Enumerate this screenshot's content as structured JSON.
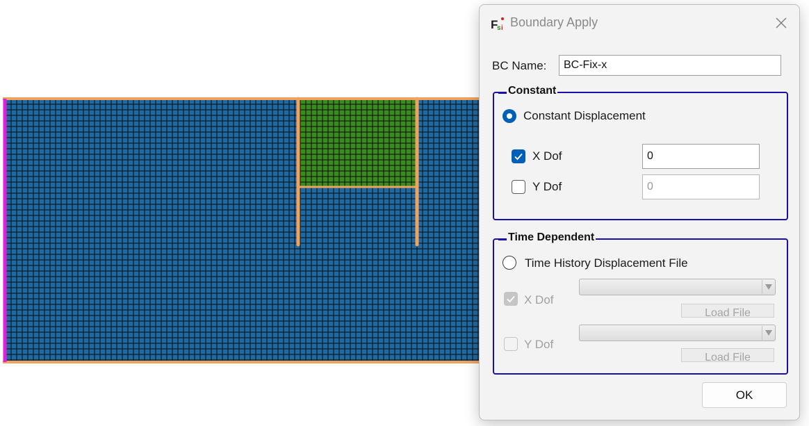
{
  "dialog": {
    "title": "Boundary Apply",
    "bc_name_label": "BC Name:",
    "bc_name_value": "BC-Fix-x",
    "constant": {
      "legend": "Constant",
      "mode_label": "Constant Displacement",
      "mode_selected": true,
      "x_dof": {
        "label": "X Dof",
        "checked": true,
        "value": "0"
      },
      "y_dof": {
        "label": "Y Dof",
        "checked": false,
        "value": "0"
      }
    },
    "time_dependent": {
      "legend": "Time Dependent",
      "mode_label": "Time History Displacement File",
      "mode_selected": false,
      "x_dof": {
        "label": "X Dof",
        "checked": true,
        "enabled": false,
        "load_label": "Load File"
      },
      "y_dof": {
        "label": "Y Dof",
        "checked": false,
        "enabled": false,
        "load_label": "Load File"
      }
    },
    "ok_label": "OK"
  },
  "mesh": {
    "colors": {
      "soil_fill": "#1e6aa4",
      "wall_fill": "#3a8a1e",
      "mesh_line": "#111111",
      "boundary_edge": "#f0a35e",
      "left_boundary": "#e020d8"
    }
  },
  "colors": {
    "accent": "#005fb8",
    "group_border": "#1a0fa8",
    "dialog_bg": "#f3f3f3"
  }
}
